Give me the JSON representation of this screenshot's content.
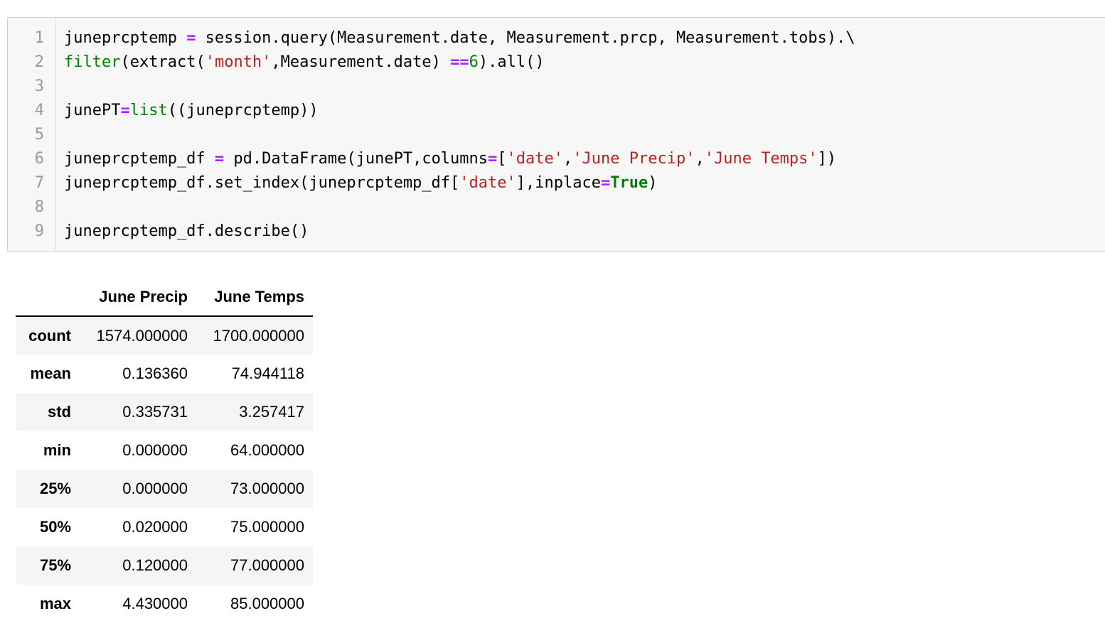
{
  "code_cell": {
    "line_numbers": [
      "1",
      "2",
      "3",
      "4",
      "5",
      "6",
      "7",
      "8",
      "9"
    ],
    "lines": [
      [
        {
          "t": "plain",
          "v": "juneprcptemp "
        },
        {
          "t": "op",
          "v": "="
        },
        {
          "t": "plain",
          "v": " session.query(Measurement.date, Measurement.prcp, Measurement.tobs).\\"
        }
      ],
      [
        {
          "t": "builtin",
          "v": "filter"
        },
        {
          "t": "plain",
          "v": "(extract("
        },
        {
          "t": "str",
          "v": "'month'"
        },
        {
          "t": "plain",
          "v": ",Measurement.date) "
        },
        {
          "t": "op",
          "v": "=="
        },
        {
          "t": "num",
          "v": "6"
        },
        {
          "t": "plain",
          "v": ").all()"
        }
      ],
      [],
      [
        {
          "t": "plain",
          "v": "junePT"
        },
        {
          "t": "op",
          "v": "="
        },
        {
          "t": "builtin",
          "v": "list"
        },
        {
          "t": "plain",
          "v": "((juneprcptemp))"
        }
      ],
      [],
      [
        {
          "t": "plain",
          "v": "juneprcptemp_df "
        },
        {
          "t": "op",
          "v": "="
        },
        {
          "t": "plain",
          "v": " pd.DataFrame(junePT,columns"
        },
        {
          "t": "op",
          "v": "="
        },
        {
          "t": "plain",
          "v": "["
        },
        {
          "t": "str",
          "v": "'date'"
        },
        {
          "t": "plain",
          "v": ","
        },
        {
          "t": "str",
          "v": "'June Precip'"
        },
        {
          "t": "plain",
          "v": ","
        },
        {
          "t": "str",
          "v": "'June Temps'"
        },
        {
          "t": "plain",
          "v": "])"
        }
      ],
      [
        {
          "t": "plain",
          "v": "juneprcptemp_df.set_index(juneprcptemp_df["
        },
        {
          "t": "str",
          "v": "'date'"
        },
        {
          "t": "plain",
          "v": "],inplace"
        },
        {
          "t": "op",
          "v": "="
        },
        {
          "t": "kw",
          "v": "True"
        },
        {
          "t": "plain",
          "v": ")"
        }
      ],
      [],
      [
        {
          "t": "plain",
          "v": "juneprcptemp_df.describe()"
        }
      ]
    ]
  },
  "output_table": {
    "columns": [
      "",
      "June Precip",
      "June Temps"
    ],
    "rows": [
      {
        "label": "count",
        "values": [
          "1574.000000",
          "1700.000000"
        ]
      },
      {
        "label": "mean",
        "values": [
          "0.136360",
          "74.944118"
        ]
      },
      {
        "label": "std",
        "values": [
          "0.335731",
          "3.257417"
        ]
      },
      {
        "label": "min",
        "values": [
          "0.000000",
          "64.000000"
        ]
      },
      {
        "label": "25%",
        "values": [
          "0.000000",
          "73.000000"
        ]
      },
      {
        "label": "50%",
        "values": [
          "0.020000",
          "75.000000"
        ]
      },
      {
        "label": "75%",
        "values": [
          "0.120000",
          "77.000000"
        ]
      },
      {
        "label": "max",
        "values": [
          "4.430000",
          "85.000000"
        ]
      }
    ]
  }
}
